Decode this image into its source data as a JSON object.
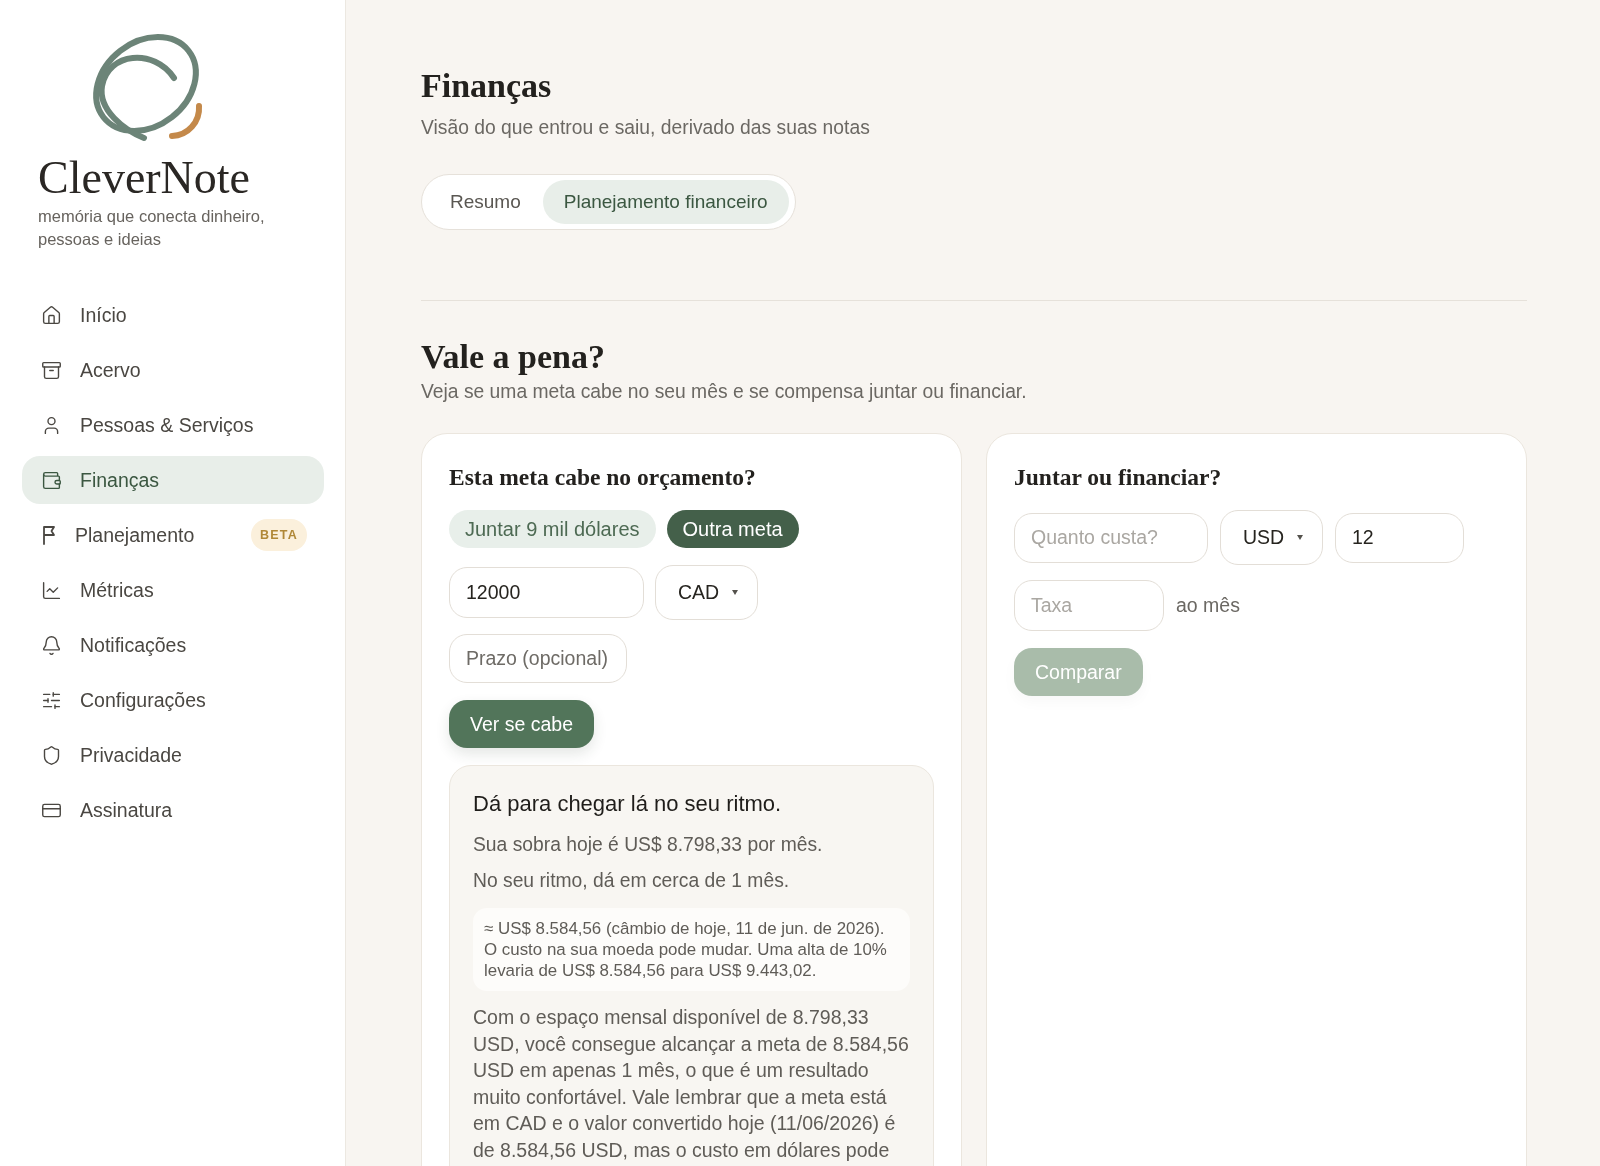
{
  "sidebar": {
    "brand": {
      "name": "CleverNote",
      "tagline": "memória que conecta dinheiro, pessoas e ideias"
    },
    "items": [
      {
        "label": "Início",
        "selected": false
      },
      {
        "label": "Acervo",
        "selected": false
      },
      {
        "label": "Pessoas & Serviços",
        "selected": false
      },
      {
        "label": "Finanças",
        "selected": true
      },
      {
        "label": "Planejamento",
        "selected": false,
        "badge": "BETA"
      },
      {
        "label": "Métricas",
        "selected": false
      },
      {
        "label": "Notificações",
        "selected": false
      },
      {
        "label": "Configurações",
        "selected": false
      },
      {
        "label": "Privacidade",
        "selected": false
      },
      {
        "label": "Assinatura",
        "selected": false
      }
    ]
  },
  "page": {
    "title": "Finanças",
    "subtitle": "Visão do que entrou e saiu, derivado das suas notas",
    "tabs": [
      {
        "label": "Resumo",
        "selected": false
      },
      {
        "label": "Planejamento financeiro",
        "selected": true
      }
    ]
  },
  "section": {
    "title": "Vale a pena?",
    "subtitle": "Veja se uma meta cabe no seu mês e se compensa juntar ou financiar."
  },
  "budget_card": {
    "title": "Esta meta cabe no orçamento?",
    "goal_options": [
      {
        "label": "Juntar 9 mil dólares",
        "selected": false
      },
      {
        "label": "Outra meta",
        "selected": true
      }
    ],
    "amount_field": {
      "value": "12000"
    },
    "currency_select": {
      "value": "CAD"
    },
    "deadline_field": {
      "placeholder": "Prazo (opcional)"
    },
    "button": {
      "label": "Ver se cabe",
      "disabled": false
    },
    "result": {
      "title": "Dá para chegar lá no seu ritmo.",
      "lines": [
        "Sua sobra hoje é US$ 8.798,33 por mês.",
        "No seu ritmo, dá em cerca de 1 mês."
      ],
      "note": "≈ US$ 8.584,56 (câmbio de hoje, 11 de jun. de 2026). O custo na sua moeda pode mudar. Uma alta de 10% levaria de US$ 8.584,56 para US$ 9.443,02.",
      "explanation": "Com o espaço mensal disponível de 8.798,33 USD, você consegue alcançar a meta de 8.584,56 USD em apenas 1 mês, o que é um resultado muito confortável. Vale lembrar que a meta está em CAD e o valor convertido hoje (11/06/2026) é de 8.584,56 USD, mas o custo em dólares pode"
    }
  },
  "compare_card": {
    "title": "Juntar ou financiar?",
    "cost_field": {
      "placeholder": "Quanto custa?"
    },
    "currency_select": {
      "value": "USD"
    },
    "months_field": {
      "value": "12"
    },
    "rate_field": {
      "placeholder": "Taxa"
    },
    "rate_suffix": "ao mês",
    "button": {
      "label": "Comparar",
      "disabled": true
    }
  }
}
